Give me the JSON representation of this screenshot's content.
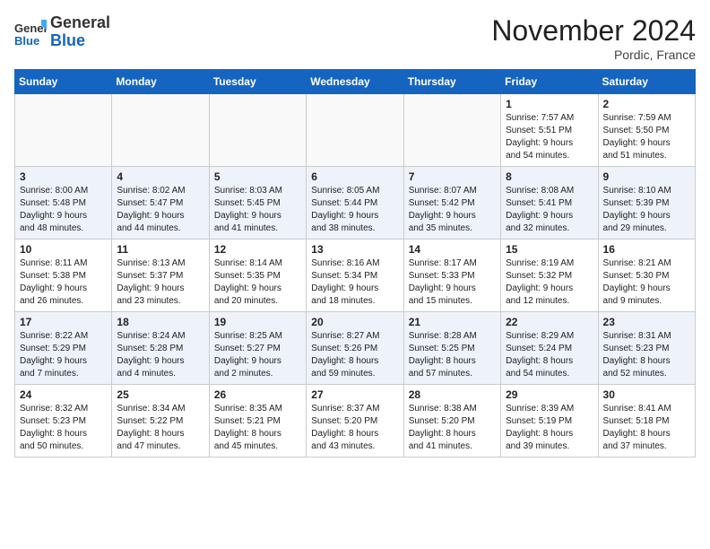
{
  "header": {
    "logo_line1": "General",
    "logo_line2": "Blue",
    "month": "November 2024",
    "location": "Pordic, France"
  },
  "days_of_week": [
    "Sunday",
    "Monday",
    "Tuesday",
    "Wednesday",
    "Thursday",
    "Friday",
    "Saturday"
  ],
  "weeks": [
    [
      {
        "day": "",
        "info": ""
      },
      {
        "day": "",
        "info": ""
      },
      {
        "day": "",
        "info": ""
      },
      {
        "day": "",
        "info": ""
      },
      {
        "day": "",
        "info": ""
      },
      {
        "day": "1",
        "info": "Sunrise: 7:57 AM\nSunset: 5:51 PM\nDaylight: 9 hours\nand 54 minutes."
      },
      {
        "day": "2",
        "info": "Sunrise: 7:59 AM\nSunset: 5:50 PM\nDaylight: 9 hours\nand 51 minutes."
      }
    ],
    [
      {
        "day": "3",
        "info": "Sunrise: 8:00 AM\nSunset: 5:48 PM\nDaylight: 9 hours\nand 48 minutes."
      },
      {
        "day": "4",
        "info": "Sunrise: 8:02 AM\nSunset: 5:47 PM\nDaylight: 9 hours\nand 44 minutes."
      },
      {
        "day": "5",
        "info": "Sunrise: 8:03 AM\nSunset: 5:45 PM\nDaylight: 9 hours\nand 41 minutes."
      },
      {
        "day": "6",
        "info": "Sunrise: 8:05 AM\nSunset: 5:44 PM\nDaylight: 9 hours\nand 38 minutes."
      },
      {
        "day": "7",
        "info": "Sunrise: 8:07 AM\nSunset: 5:42 PM\nDaylight: 9 hours\nand 35 minutes."
      },
      {
        "day": "8",
        "info": "Sunrise: 8:08 AM\nSunset: 5:41 PM\nDaylight: 9 hours\nand 32 minutes."
      },
      {
        "day": "9",
        "info": "Sunrise: 8:10 AM\nSunset: 5:39 PM\nDaylight: 9 hours\nand 29 minutes."
      }
    ],
    [
      {
        "day": "10",
        "info": "Sunrise: 8:11 AM\nSunset: 5:38 PM\nDaylight: 9 hours\nand 26 minutes."
      },
      {
        "day": "11",
        "info": "Sunrise: 8:13 AM\nSunset: 5:37 PM\nDaylight: 9 hours\nand 23 minutes."
      },
      {
        "day": "12",
        "info": "Sunrise: 8:14 AM\nSunset: 5:35 PM\nDaylight: 9 hours\nand 20 minutes."
      },
      {
        "day": "13",
        "info": "Sunrise: 8:16 AM\nSunset: 5:34 PM\nDaylight: 9 hours\nand 18 minutes."
      },
      {
        "day": "14",
        "info": "Sunrise: 8:17 AM\nSunset: 5:33 PM\nDaylight: 9 hours\nand 15 minutes."
      },
      {
        "day": "15",
        "info": "Sunrise: 8:19 AM\nSunset: 5:32 PM\nDaylight: 9 hours\nand 12 minutes."
      },
      {
        "day": "16",
        "info": "Sunrise: 8:21 AM\nSunset: 5:30 PM\nDaylight: 9 hours\nand 9 minutes."
      }
    ],
    [
      {
        "day": "17",
        "info": "Sunrise: 8:22 AM\nSunset: 5:29 PM\nDaylight: 9 hours\nand 7 minutes."
      },
      {
        "day": "18",
        "info": "Sunrise: 8:24 AM\nSunset: 5:28 PM\nDaylight: 9 hours\nand 4 minutes."
      },
      {
        "day": "19",
        "info": "Sunrise: 8:25 AM\nSunset: 5:27 PM\nDaylight: 9 hours\nand 2 minutes."
      },
      {
        "day": "20",
        "info": "Sunrise: 8:27 AM\nSunset: 5:26 PM\nDaylight: 8 hours\nand 59 minutes."
      },
      {
        "day": "21",
        "info": "Sunrise: 8:28 AM\nSunset: 5:25 PM\nDaylight: 8 hours\nand 57 minutes."
      },
      {
        "day": "22",
        "info": "Sunrise: 8:29 AM\nSunset: 5:24 PM\nDaylight: 8 hours\nand 54 minutes."
      },
      {
        "day": "23",
        "info": "Sunrise: 8:31 AM\nSunset: 5:23 PM\nDaylight: 8 hours\nand 52 minutes."
      }
    ],
    [
      {
        "day": "24",
        "info": "Sunrise: 8:32 AM\nSunset: 5:23 PM\nDaylight: 8 hours\nand 50 minutes."
      },
      {
        "day": "25",
        "info": "Sunrise: 8:34 AM\nSunset: 5:22 PM\nDaylight: 8 hours\nand 47 minutes."
      },
      {
        "day": "26",
        "info": "Sunrise: 8:35 AM\nSunset: 5:21 PM\nDaylight: 8 hours\nand 45 minutes."
      },
      {
        "day": "27",
        "info": "Sunrise: 8:37 AM\nSunset: 5:20 PM\nDaylight: 8 hours\nand 43 minutes."
      },
      {
        "day": "28",
        "info": "Sunrise: 8:38 AM\nSunset: 5:20 PM\nDaylight: 8 hours\nand 41 minutes."
      },
      {
        "day": "29",
        "info": "Sunrise: 8:39 AM\nSunset: 5:19 PM\nDaylight: 8 hours\nand 39 minutes."
      },
      {
        "day": "30",
        "info": "Sunrise: 8:41 AM\nSunset: 5:18 PM\nDaylight: 8 hours\nand 37 minutes."
      }
    ]
  ]
}
